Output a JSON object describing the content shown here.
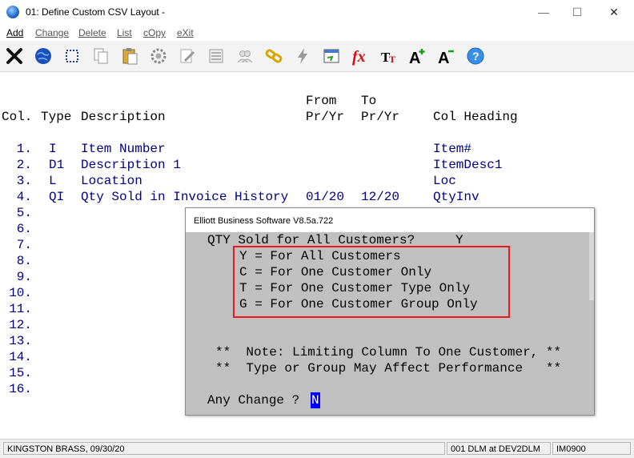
{
  "window": {
    "title": "01: Define Custom CSV Layout -",
    "minimize": "—",
    "maximize": "☐",
    "close": "✕"
  },
  "menu": {
    "items": [
      {
        "label": "Add",
        "key": "A"
      },
      {
        "label": "Change",
        "key": "C"
      },
      {
        "label": "Delete",
        "key": "D"
      },
      {
        "label": "List",
        "key": "L"
      },
      {
        "label": "cOpy",
        "key": "O"
      },
      {
        "label": "eXit",
        "key": "X"
      }
    ]
  },
  "toolbar": {
    "icons": [
      "close-x-icon",
      "globe-icon",
      "select-icon",
      "copy-icon",
      "paste-icon",
      "settings-icon",
      "edit-icon",
      "list-icon",
      "users-icon",
      "link-icon",
      "lightning-icon",
      "wizard-icon",
      "function-fx-icon",
      "text-size-icon",
      "font-increase-icon",
      "font-decrease-icon",
      "help-icon"
    ]
  },
  "screen": {
    "header": {
      "from": "From",
      "to": "To",
      "col": "Col.",
      "type": "Type",
      "description": "Description",
      "from_period": "Pr/Yr",
      "to_period": "Pr/Yr",
      "col_heading": "Col Heading"
    },
    "rows": [
      {
        "num": "1.",
        "type": "I",
        "desc": "Item Number",
        "from": "",
        "to": "",
        "heading": "Item#"
      },
      {
        "num": "2.",
        "type": "D1",
        "desc": "Description 1",
        "from": "",
        "to": "",
        "heading": "ItemDesc1"
      },
      {
        "num": "3.",
        "type": "L",
        "desc": "Location",
        "from": "",
        "to": "",
        "heading": "Loc"
      },
      {
        "num": "4.",
        "type": "QI",
        "desc": "Qty Sold in Invoice History",
        "from": "01/20",
        "to": "12/20",
        "heading": "QtyInv"
      },
      {
        "num": "5.",
        "type": "",
        "desc": "",
        "from": "",
        "to": "",
        "heading": ""
      },
      {
        "num": "6.",
        "type": "",
        "desc": "",
        "from": "",
        "to": "",
        "heading": ""
      },
      {
        "num": "7.",
        "type": "",
        "desc": "",
        "from": "",
        "to": "",
        "heading": ""
      },
      {
        "num": "8.",
        "type": "",
        "desc": "",
        "from": "",
        "to": "",
        "heading": ""
      },
      {
        "num": "9.",
        "type": "",
        "desc": "",
        "from": "",
        "to": "",
        "heading": ""
      },
      {
        "num": "10.",
        "type": "",
        "desc": "",
        "from": "",
        "to": "",
        "heading": ""
      },
      {
        "num": "11.",
        "type": "",
        "desc": "",
        "from": "",
        "to": "",
        "heading": ""
      },
      {
        "num": "12.",
        "type": "",
        "desc": "",
        "from": "",
        "to": "",
        "heading": ""
      },
      {
        "num": "13.",
        "type": "",
        "desc": "",
        "from": "",
        "to": "",
        "heading": ""
      },
      {
        "num": "14.",
        "type": "",
        "desc": "",
        "from": "",
        "to": "",
        "heading": ""
      },
      {
        "num": "15.",
        "type": "",
        "desc": "",
        "from": "",
        "to": "",
        "heading": ""
      },
      {
        "num": "16.",
        "type": "",
        "desc": "",
        "from": "",
        "to": "",
        "heading": ""
      }
    ]
  },
  "dialog": {
    "title": "Elliott Business Software V8.5a.722",
    "question": "QTY Sold for All Customers?",
    "question_value": "Y",
    "options": [
      "Y = For All Customers",
      "C = For One Customer Only",
      "T = For One Customer Type Only",
      "G = For One Customer Group Only"
    ],
    "note_line1": "**  Note: Limiting Column To One Customer, **",
    "note_line2": "**  Type or Group May Affect Performance   **",
    "prompt": "Any Change ?",
    "prompt_value": "N"
  },
  "status": {
    "company": "KINGSTON BRASS, 09/30/20",
    "session": "001 DLM at DEV2DLM",
    "program": "IM0900"
  },
  "colors": {
    "screen_text": "#000080",
    "dialog_bg": "#c0c0c0",
    "highlight_box": "#e81a1a",
    "cursor": "#0000ff"
  }
}
